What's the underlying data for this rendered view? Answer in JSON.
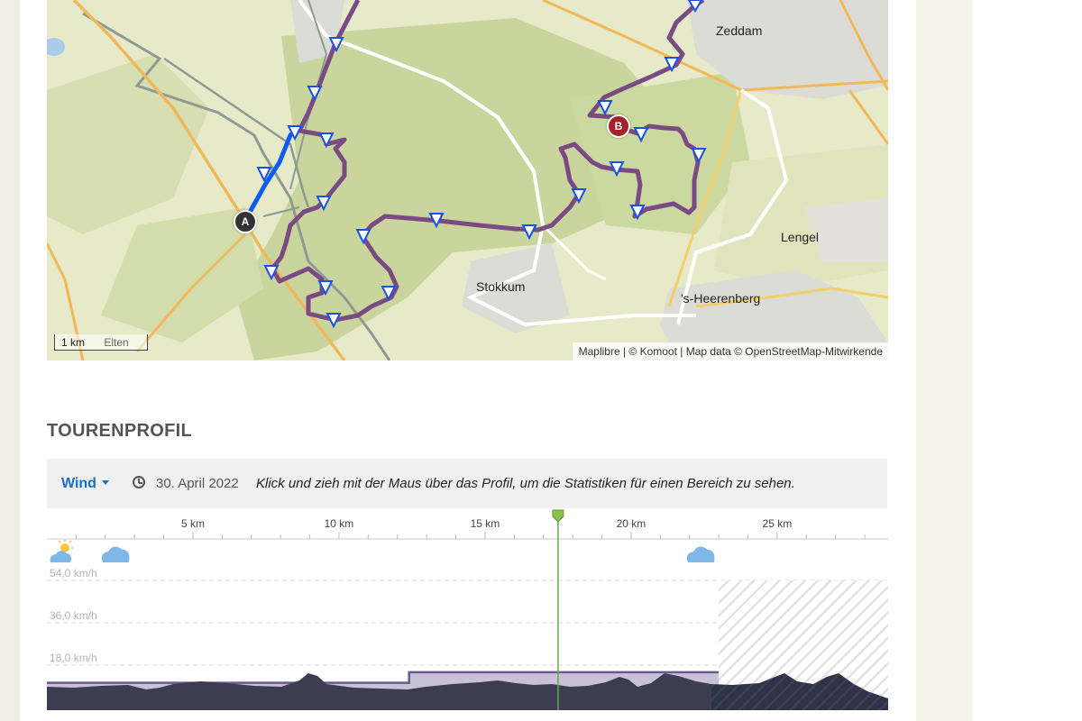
{
  "map": {
    "places": [
      {
        "name": "Zeddam"
      },
      {
        "name": "Lengel"
      },
      {
        "name": "Stokkum"
      },
      {
        "name": "'s-Heerenberg"
      },
      {
        "name": "Elten"
      }
    ],
    "start_marker": "A",
    "end_marker": "B",
    "scale_label": "1 km",
    "attribution": "Maplibre | © Komoot | Map data © OpenStreetMap-Mitwirkende"
  },
  "profile": {
    "title": "TOURENPROFIL",
    "mode_label": "Wind",
    "date": "30. April 2022",
    "hint": "Klick und zieh mit der Maus über das Profil, um die Statistiken für einen Bereich zu sehen.",
    "weather_icons": [
      "partly-sunny-icon",
      "cloud-icon",
      "cloud-icon"
    ]
  },
  "chart_data": {
    "type": "area",
    "x_unit": "km",
    "x_ticks": [
      "5 km",
      "10 km",
      "15 km",
      "20 km",
      "25 km"
    ],
    "y_ticks": [
      "18,0 km/h",
      "36,0 km/h",
      "54,0 km/h"
    ],
    "ylim": [
      0,
      54
    ],
    "xlim": [
      0,
      28.8
    ],
    "cursor_km": 17.5,
    "forecast_end_km": 23,
    "wind_series": {
      "x": [
        0,
        12.4,
        12.4,
        23
      ],
      "y": [
        10.5,
        10.5,
        15,
        15
      ]
    },
    "color_wind": "#6b5a8a",
    "color_elevation": "#3d3d52",
    "color_cursor": "#6aa84f"
  }
}
